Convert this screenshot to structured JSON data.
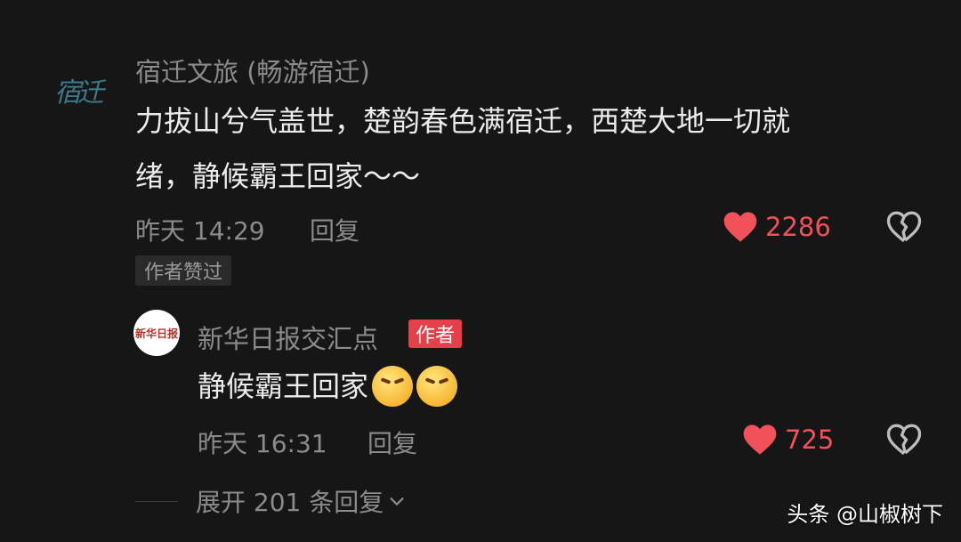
{
  "comment": {
    "avatar_text": "宿迁",
    "username": "宿迁文旅 (畅游宿迁)",
    "text_line1": "力拔山兮气盖世，楚韵春色满宿迁，西楚大地一切就",
    "text_line2": "绪，静候霸王回家～～",
    "time": "昨天 14:29",
    "reply_label": "回复",
    "like_count": "2286",
    "author_liked_tag": "作者赞过"
  },
  "reply": {
    "avatar_text": "新华日报",
    "username": "新华日报交汇点",
    "author_badge": "作者",
    "text": "静候霸王回家",
    "time": "昨天 16:31",
    "reply_label": "回复",
    "like_count": "725"
  },
  "expand_label": "展开 201 条回复",
  "watermark": "头条 @山椒树下",
  "colors": {
    "like_red": "#f0515a",
    "badge_red": "#e5404a",
    "background": "#161616"
  }
}
